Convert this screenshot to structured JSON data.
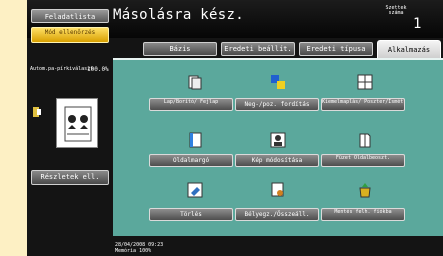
{
  "header": {
    "title": "Másolásra kész.",
    "jobs_button": "Feladatlista",
    "check_button": "Mód ellenőrzés",
    "copies_label": "Szettek száma",
    "copies_value": "1"
  },
  "tabs": [
    {
      "label": "Bázis",
      "active": false
    },
    {
      "label": "Eredeti beállít.",
      "active": false
    },
    {
      "label": "Eredeti típusa",
      "active": false
    },
    {
      "label": "Alkalmazás",
      "active": true
    }
  ],
  "left": {
    "zoom_label": "Autom.pa-pírkiválaszt",
    "zoom_value": "100.0%",
    "details_button": "Részletek ell."
  },
  "functions": [
    {
      "label": "Lap/Borító/ Fejlap",
      "icon": "page-cover-icon"
    },
    {
      "label": "Neg-/poz. fordítás",
      "icon": "neg-pos-icon"
    },
    {
      "label": "Kiemelmaplás/ Poszter/Ismétl",
      "icon": "combine-poster-icon"
    },
    {
      "label": "Oldalmargó",
      "icon": "page-margin-icon"
    },
    {
      "label": "Kép módosítása",
      "icon": "image-adjust-icon"
    },
    {
      "label": "Füzet Oldalbeoszt.",
      "icon": "booklet-icon"
    },
    {
      "label": "Törlés",
      "icon": "erase-icon"
    },
    {
      "label": "Bélyegz./Összeáll.",
      "icon": "stamp-icon"
    },
    {
      "label": "Mentés felh. fiókba",
      "icon": "save-box-icon"
    }
  ],
  "footer": {
    "datetime": "28/04/2008   09:23",
    "memory": "Memória        100%"
  }
}
